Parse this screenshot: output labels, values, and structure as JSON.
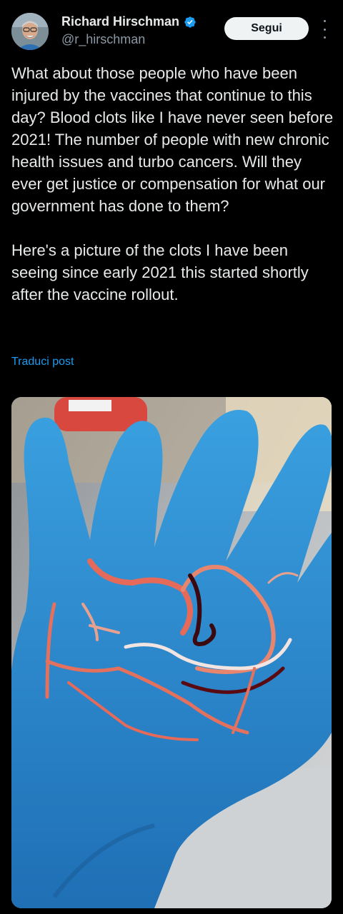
{
  "author": {
    "display_name": "Richard Hirschman",
    "handle": "@r_hirschman",
    "verified_icon": "verified-badge-icon",
    "avatar_icon": "avatar"
  },
  "actions": {
    "follow_label": "Segui",
    "more_icon": "more-options-icon"
  },
  "post": {
    "paragraphs": [
      "What about those people who have been injured by the vaccines that continue to this day? Blood clots like I have never seen before 2021! The number of people with new chronic health issues and turbo cancers. Will they ever get justice or compensation for what our government has done to them?",
      "Here's a picture of the clots I have been seeing since early 2021 this started shortly after the vaccine rollout."
    ],
    "translate_label": "Traduci post"
  },
  "colors": {
    "background": "#000000",
    "text": "#e7e9ea",
    "secondary": "#8b98a5",
    "link": "#1d9bf0",
    "verified": "#1d9bf0",
    "glove": "#2f8fd0"
  }
}
